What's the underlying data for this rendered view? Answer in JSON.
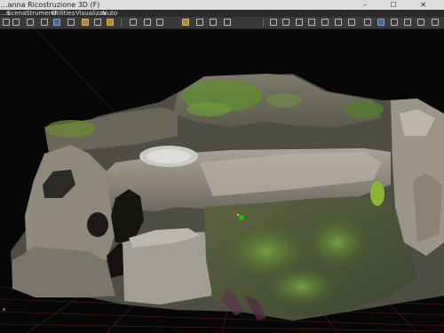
{
  "window": {
    "title": "...anna Ricostruzione 3D (F)",
    "controls": "– ☐ ✕"
  },
  "menu": [
    "...a",
    "Scena",
    "Strumenti",
    "Utilities",
    "Visualizza",
    "Aiuto"
  ],
  "toolbar_icons": [
    "new-icon",
    "open-icon",
    "save-icon",
    "camera-icon",
    "rotate-icon",
    "refresh-icon",
    "lasso-icon",
    "light-icon",
    "marker-icon",
    "warning-icon",
    "grid-icon",
    "move-icon",
    "scale-icon",
    "box-icon",
    "text-icon",
    "select-icon",
    "measure-icon",
    "section-icon",
    "pointcloud-icon",
    "mesh-icon",
    "texture-icon",
    "export-icon",
    "home-icon",
    "zoom-in-icon",
    "zoom-out-icon"
  ],
  "colors": {
    "accent": "#b48a2c",
    "grid": "#6a2020",
    "axis_green": "#18c018",
    "background": "#070707"
  }
}
